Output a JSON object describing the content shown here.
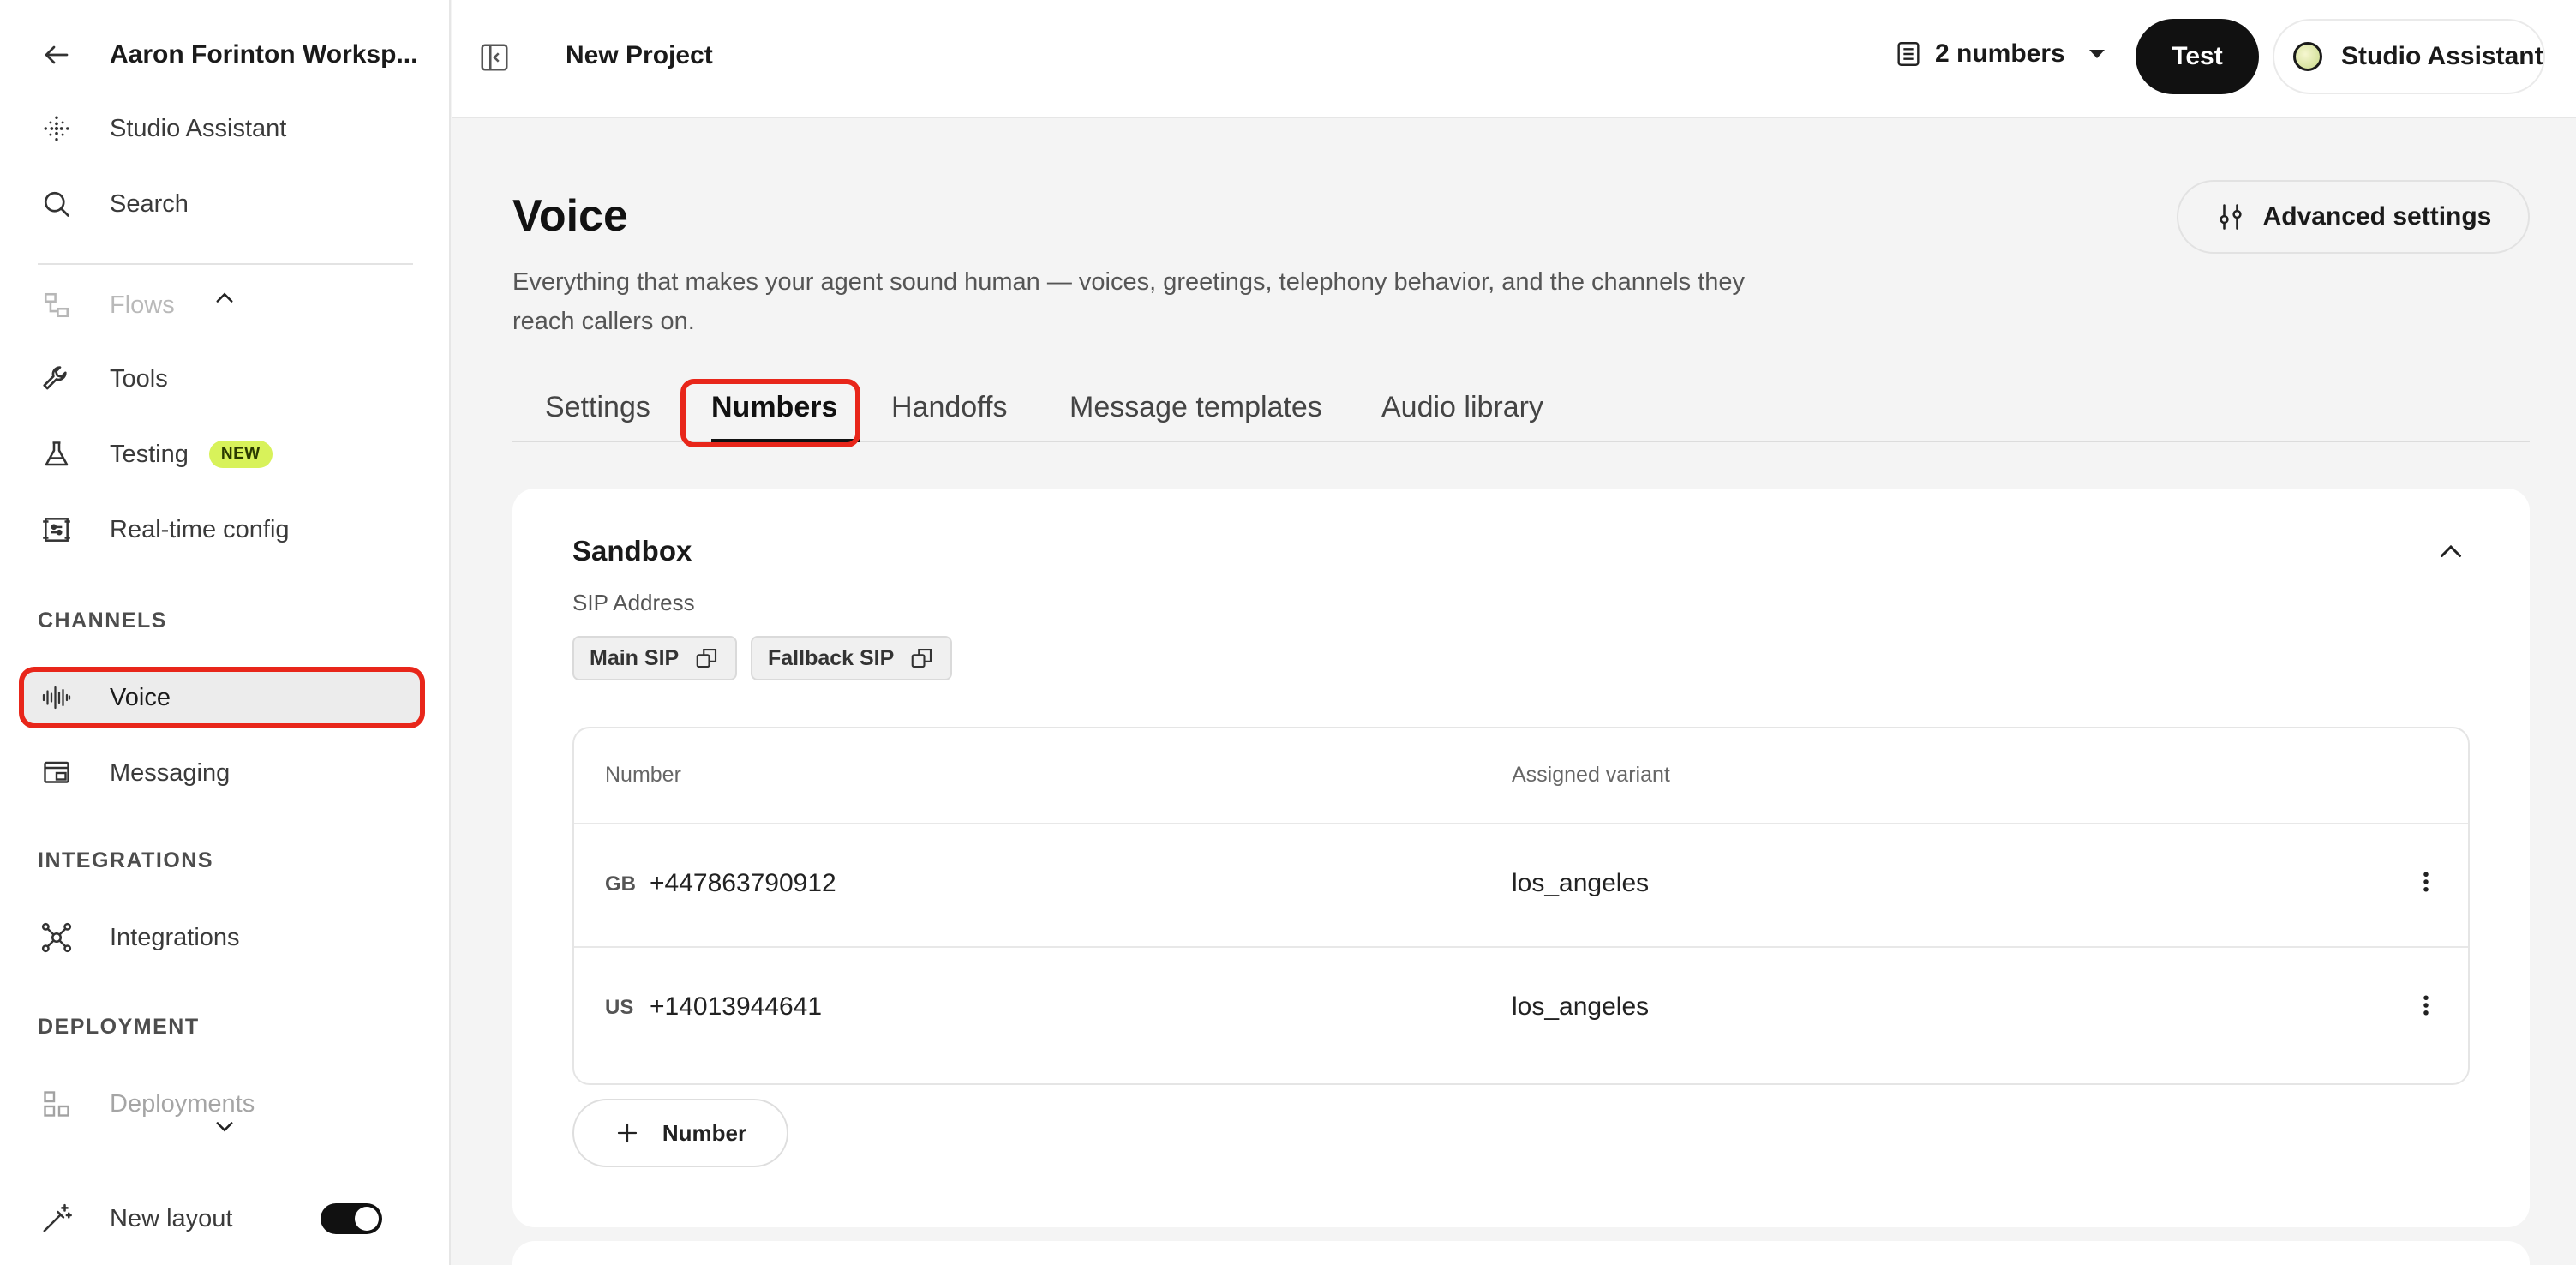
{
  "sidebar": {
    "workspace_title": "Aaron Forinton Worksp...",
    "items": {
      "studio_assistant": "Studio Assistant",
      "search": "Search",
      "flows": "Flows",
      "tools": "Tools",
      "testing": "Testing",
      "testing_badge": "NEW",
      "realtime": "Real-time config",
      "voice": "Voice",
      "messaging": "Messaging",
      "integrations": "Integrations",
      "deployments": "Deployments",
      "new_layout": "New layout"
    },
    "sections": {
      "channels": "CHANNELS",
      "integrations": "INTEGRATIONS",
      "deployment": "DEPLOYMENT"
    },
    "new_layout_enabled": true
  },
  "topbar": {
    "project_title": "New Project",
    "numbers_dropdown": "2 numbers",
    "test_label": "Test",
    "assistant_label": "Studio Assistant"
  },
  "main": {
    "title": "Voice",
    "description": "Everything that makes your agent sound human — voices, greetings, telephony behavior, and the channels they reach callers on.",
    "advanced_settings": "Advanced settings",
    "tabs": [
      "Settings",
      "Numbers",
      "Handoffs",
      "Message templates",
      "Audio library"
    ],
    "active_tab": "Numbers"
  },
  "sandbox": {
    "title": "Sandbox",
    "sip_label": "SIP Address",
    "main_sip": "Main SIP",
    "fallback_sip": "Fallback SIP",
    "columns": {
      "number": "Number",
      "variant": "Assigned variant"
    },
    "rows": [
      {
        "country": "GB",
        "number": "+447863790912",
        "variant": "los_angeles"
      },
      {
        "country": "US",
        "number": "+14013944641",
        "variant": "los_angeles"
      }
    ],
    "add_number_label": "Number"
  },
  "colors": {
    "highlight": "#e8261a",
    "new_badge": "#d8f25a",
    "primary_button": "#111111"
  }
}
